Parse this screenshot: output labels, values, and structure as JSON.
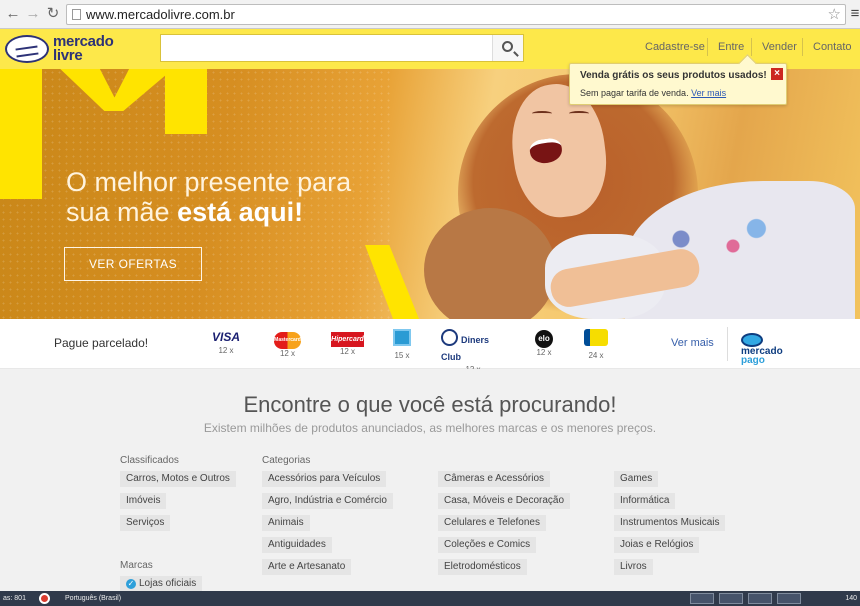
{
  "browser": {
    "url": "www.mercadolivre.com.br"
  },
  "header": {
    "logo_line1": "mercado",
    "logo_line2": "livre",
    "nav": [
      "Cadastre-se",
      "Entre",
      "Vender",
      "Contato"
    ]
  },
  "tooltip": {
    "title": "Venda grátis os seus produtos usados!",
    "text": "Sem pagar tarifa de venda.",
    "link": "Ver mais"
  },
  "hero": {
    "headline_line1": "O melhor presente para",
    "headline_line2_prefix": "sua mãe ",
    "headline_line2_bold": "está aqui!",
    "button": "VER OFERTAS"
  },
  "payment": {
    "label": "Pague parcelado!",
    "cards": [
      {
        "name": "VISA",
        "installments": "12 x"
      },
      {
        "name": "Mastercard",
        "installments": "12 x"
      },
      {
        "name": "Hipercard",
        "installments": "12 x"
      },
      {
        "name": "",
        "installments": "15 x"
      },
      {
        "name": "Diners Club",
        "installments": "12 x"
      },
      {
        "name": "elo",
        "installments": "12 x"
      },
      {
        "name": "",
        "installments": "24 x"
      }
    ],
    "more": "Ver mais",
    "mp_line1": "mercado",
    "mp_line2": "pago"
  },
  "main": {
    "title": "Encontre o que você está procurando!",
    "subtitle": "Existem milhões de produtos anunciados, as melhores marcas e os menores preços.",
    "classificados_label": "Classificados",
    "classificados": [
      "Carros, Motos e Outros",
      "Imóveis",
      "Serviços"
    ],
    "marcas_label": "Marcas",
    "marcas": [
      "Lojas oficiais"
    ],
    "categorias_label": "Categorias",
    "categorias_col1": [
      "Acessórios para Veículos",
      "Agro, Indústria e Comércio",
      "Animais",
      "Antiguidades",
      "Arte e Artesanato"
    ],
    "categorias_col2": [
      "Câmeras e Acessórios",
      "Casa, Móveis e Decoração",
      "Celulares e Telefones",
      "Coleções e Comics",
      "Eletrodomésticos"
    ],
    "categorias_col3": [
      "Games",
      "Informática",
      "Instrumentos Musicais",
      "Joias e Relógios",
      "Livros"
    ]
  },
  "taskbar": {
    "left": "as: 801",
    "language": "Português (Brasil)",
    "right": "140"
  }
}
